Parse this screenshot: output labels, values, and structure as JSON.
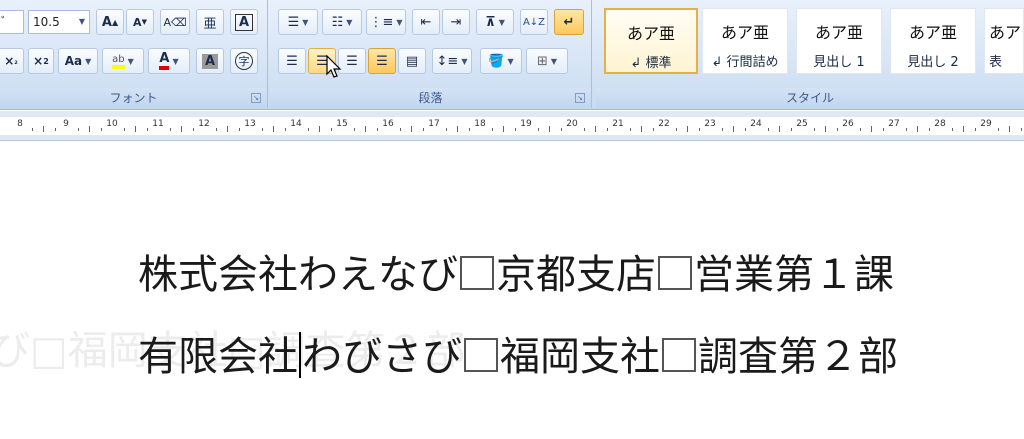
{
  "font_group": {
    "label": "フォント",
    "font_size": "10.5",
    "buttons": [
      "A",
      "A",
      "A",
      "x₂",
      "x²",
      "Aa",
      "ab",
      "A",
      "A",
      "字"
    ]
  },
  "paragraph_group": {
    "label": "段落"
  },
  "styles_group": {
    "label": "スタイル",
    "tiles": [
      {
        "sample": "あア亜",
        "name": "↲ 標準"
      },
      {
        "sample": "あア亜",
        "name": "↲ 行間詰め"
      },
      {
        "sample": "あア亜",
        "name": "見出し 1"
      },
      {
        "sample": "あア亜",
        "name": "見出し 2"
      },
      {
        "sample": "あア",
        "name": "表"
      }
    ]
  },
  "ruler": {
    "ticks": [
      "8",
      "9",
      "10",
      "11",
      "12",
      "13",
      "14",
      "15",
      "16",
      "17",
      "18",
      "19",
      "20",
      "21",
      "22",
      "23",
      "24",
      "25",
      "26",
      "27",
      "28",
      "29"
    ]
  },
  "document": {
    "line1_a": "株式会社わえなび",
    "line1_b": "京都支店",
    "line1_c": "営業第１課",
    "line2_a": "有限会社",
    "line2_b": "わびさび",
    "line2_c": "福岡支社",
    "line2_d": "調査第２部",
    "ghost": "び□福岡支社□調査第２部"
  },
  "colors": {
    "active_button": "#ffc85a",
    "highlight_yellow": "#ffff00",
    "font_red": "#e00000"
  }
}
